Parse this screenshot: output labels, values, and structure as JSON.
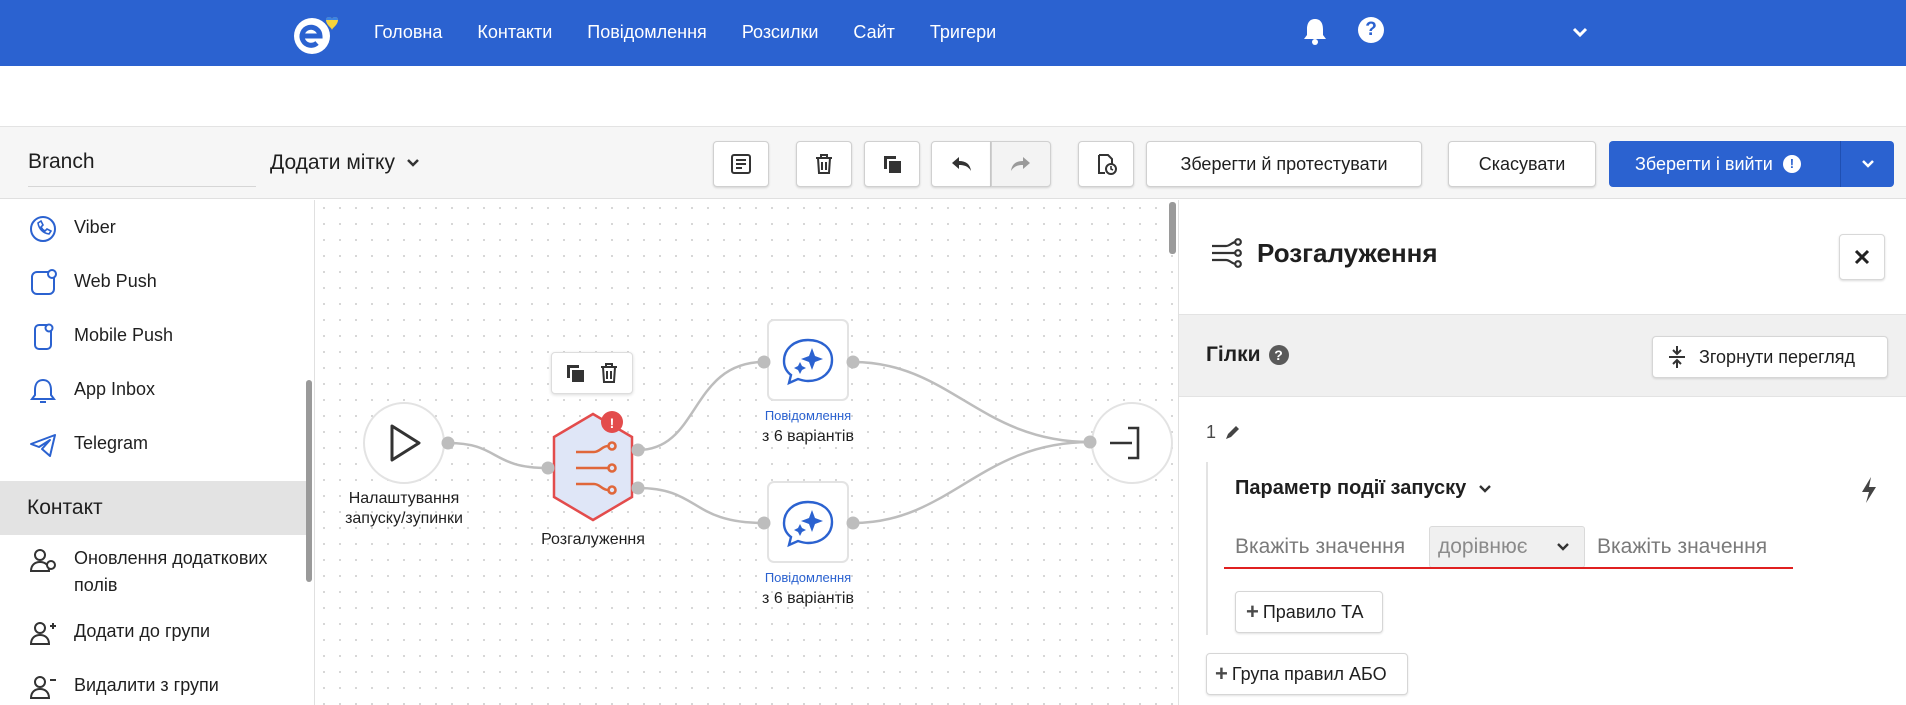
{
  "topnav": {
    "items": [
      "Головна",
      "Контакти",
      "Повідомлення",
      "Розсилки",
      "Сайт",
      "Тригери"
    ],
    "icons": [
      "logo-icon",
      "bell-icon",
      "help-icon",
      "chevron-down-icon"
    ],
    "help_glyph": "?"
  },
  "toolbar": {
    "name_value": "Branch",
    "add_tag_label": "Додати мітку",
    "save_test_label": "Зберегти й протестувати",
    "cancel_label": "Скасувати",
    "save_exit_label": "Зберегти і вийти",
    "warn_glyph": "!"
  },
  "sidebar": {
    "channels": [
      "Viber",
      "Web Push",
      "Mobile Push",
      "App Inbox",
      "Telegram"
    ],
    "section_title": "Контакт",
    "contact_items": [
      "Оновлення додаткових полів",
      "Додати до групи",
      "Видалити з групи"
    ]
  },
  "canvas": {
    "start_label_1": "Налаштування",
    "start_label_2": "запуску/зупинки",
    "branch_label": "Розгалуження",
    "msg1_sub": "Повідомлення",
    "msg1_label": "з 6 варіантів",
    "msg2_sub": "Повідомлення",
    "msg2_label": "з 6 варіантів",
    "warn_badge": "!"
  },
  "panel": {
    "title": "Розгалуження",
    "branches_title": "Гілки",
    "collapse_label": "Згорнути перегляд",
    "rule_number": "1",
    "param_title": "Параметр події запуску",
    "value_placeholder_left": "Вкажіть значення",
    "operator_value": "дорівнює",
    "value_placeholder_right": "Вкажіть значення",
    "and_rule_label": "Правило ТА",
    "or_group_label": "Група правил АБО",
    "plus_glyph": "+",
    "qmark_glyph": "?"
  },
  "colors": {
    "brand_blue": "#2b62d0",
    "branch_node_fill": "#dfe6f7",
    "branch_node_border": "#e34c4c",
    "error_red": "#e02020"
  }
}
